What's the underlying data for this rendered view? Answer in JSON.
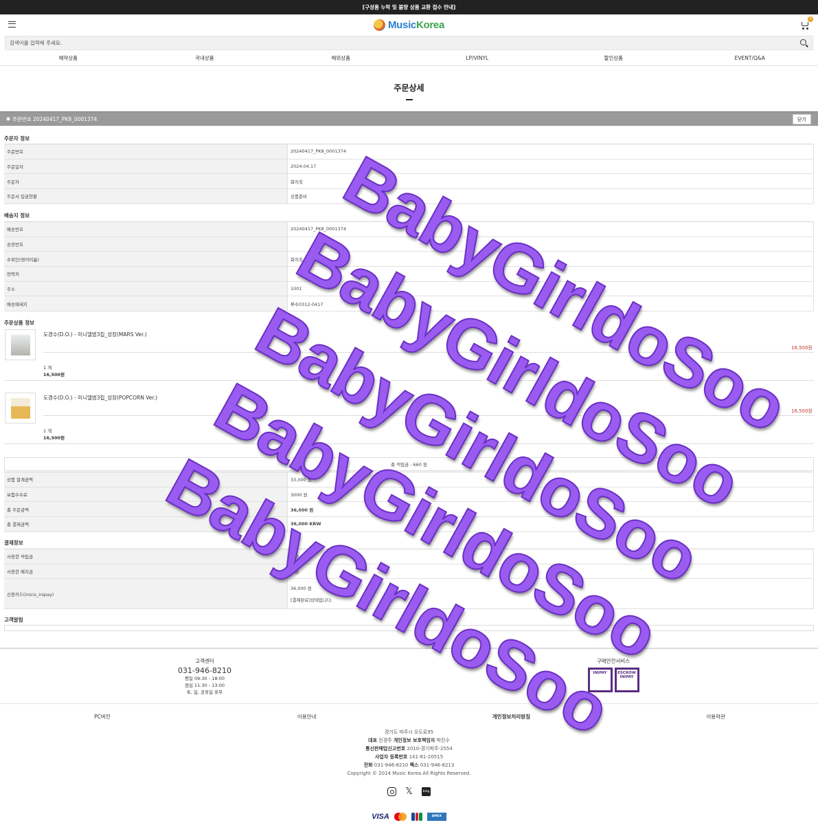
{
  "topbar": {
    "notice": "[구성품 누락 및 불량 상품 교환 접수 안내]"
  },
  "header": {
    "logo_music": "Music",
    "logo_korea": "Korea",
    "cart_count": "0"
  },
  "search": {
    "placeholder": "검색어를 입력해 주세요."
  },
  "nav": {
    "items": [
      {
        "label": "예약상품"
      },
      {
        "label": "국내상품"
      },
      {
        "label": "해외상품"
      },
      {
        "label": "LP/VINYL"
      },
      {
        "label": "할인상품"
      },
      {
        "label": "EVENT/Q&A"
      }
    ]
  },
  "page": {
    "title": "주문상세"
  },
  "order_bar": {
    "label": "주문번호 20240417_PK8_0001374",
    "close_label": "닫기"
  },
  "orderer": {
    "title": "주문자 정보",
    "rows": [
      {
        "label": "주문번호",
        "value": "20240417_PK8_0001374"
      },
      {
        "label": "주문일자",
        "value": "2024.04.17"
      },
      {
        "label": "주문자",
        "value": "화지욱"
      },
      {
        "label": "주문서 입금현황",
        "value": "상품준비"
      }
    ]
  },
  "shipping": {
    "title": "배송지 정보",
    "rows": [
      {
        "label": "배송번호",
        "value": "20240417_PK8_0001374"
      },
      {
        "label": "송장번호",
        "value": ""
      },
      {
        "label": "수취인(영어이름)",
        "value": "화지욱"
      },
      {
        "label": "연락처",
        "value": ""
      },
      {
        "label": "주소",
        "value": "1001"
      },
      {
        "label": "배송메세지",
        "value": "루수0312-0417"
      }
    ]
  },
  "products": {
    "title": "주문상품 정보",
    "items": [
      {
        "name": "도경수(D.O.) - 미니앨범3집_성장(MARS Ver.)",
        "price": "16,500원",
        "qty": "1 개",
        "subtotal": "16,500원"
      },
      {
        "name": "도경수(D.O.) - 미니앨범3집_성장(POPCORN Ver.)",
        "price": "16,500원",
        "qty": "1 개",
        "subtotal": "16,500원"
      }
    ]
  },
  "summary": {
    "points_text": "총 적립금 : 660 원",
    "rows": [
      {
        "label": "상품 합계금액",
        "value": "33,000 원"
      },
      {
        "label": "보험수수료",
        "value": "3000 원"
      },
      {
        "label": "총 주문금액",
        "value": "36,000 원"
      },
      {
        "label": "총 결제금액",
        "value": "36,000 KRW"
      }
    ]
  },
  "payment": {
    "title": "결제정보",
    "rows": [
      {
        "label": "사용한 적립금",
        "value": "0 원"
      },
      {
        "label": "사용한 예치금",
        "value": "0 원"
      }
    ],
    "card_label": "신용카드(inicis_inipay)",
    "card_amount": "36,000 원",
    "card_status": "[결제완료]상태입니다."
  },
  "memo": {
    "title": "고객알림"
  },
  "footer": {
    "cs_title": "고객센터",
    "cs_phone": "031-946-8210",
    "cs_hours": [
      "평일 09:30 - 18:00",
      "점심 11:30 - 13:00",
      "토, 일, 공휴일 휴무"
    ],
    "safe_title": "구매안전서비스",
    "inipay_label": "INIPAY",
    "escrow_label": "ESCROW INIPAY",
    "links": [
      {
        "label": "PC버전"
      },
      {
        "label": "이용안내"
      },
      {
        "label": "개인정보처리방침"
      },
      {
        "label": "이용약관"
      }
    ],
    "company": {
      "address": "경기도 파주시 오도로95",
      "ceo_label": "대표",
      "ceo": "진경주",
      "privacy_label": "개인정보 보호책임자",
      "privacy": "박진수",
      "mail_order_label": "통신판매업신고번호",
      "mail_order": "2010-경기파주-2554",
      "biz_label": "사업자 등록번호",
      "biz": "141-81-20515",
      "tel_label": "전화",
      "tel": "031-946-8210",
      "fax_label": "팩스",
      "fax": "031-946-8213",
      "copyright": "Copyright © 2014 Music Korea All Rights Reserved."
    },
    "x_glyph": "𝕏",
    "blog_label": "blog",
    "visa_label": "VISA",
    "amex_label": "AMEX"
  },
  "watermark": {
    "text": "BabyGirldoSoo"
  },
  "colors": {
    "accent_red": "#c0392b",
    "watermark": "#9a5cf0",
    "inipay": "#5a2d82"
  }
}
